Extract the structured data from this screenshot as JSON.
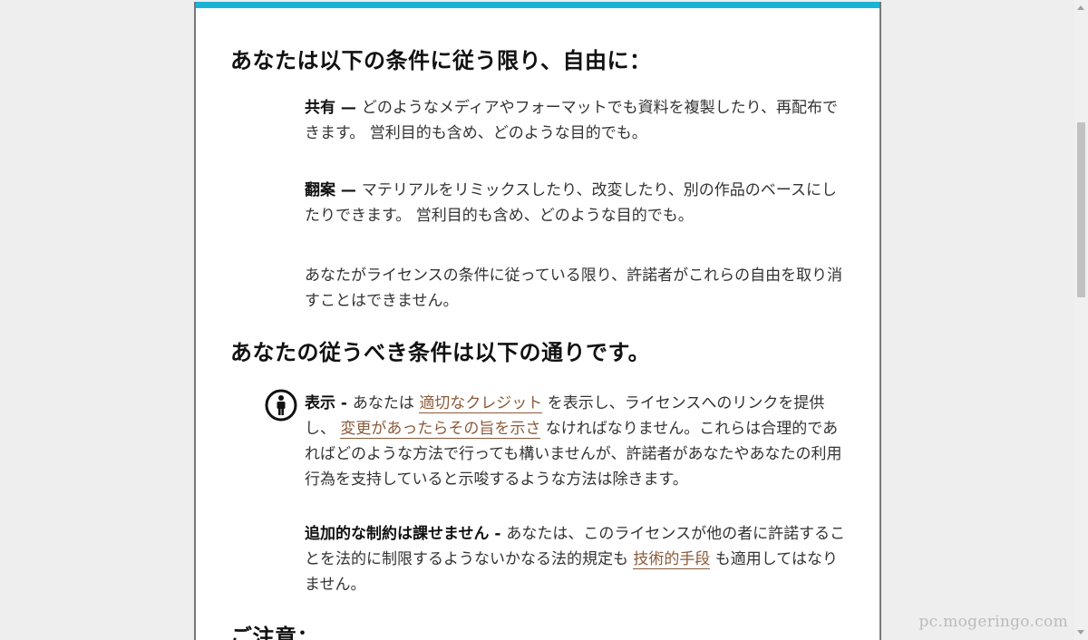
{
  "sections": {
    "freedoms_heading": "あなたは以下の条件に従う限り、自由に：",
    "conditions_heading": "あなたの従うべき条件は以下の通りです。",
    "notice_heading": "ご注意："
  },
  "freedoms": {
    "share": {
      "term": "共有",
      "sep": " — ",
      "text": "どのようなメディアやフォーマットでも資料を複製したり、再配布できます。 営利目的も含め、どのような目的でも。"
    },
    "adapt": {
      "term": "翻案",
      "sep": " — ",
      "text": "マテリアルをリミックスしたり、改変したり、別の作品のベースにしたりできます。 営利目的も含め、どのような目的でも。"
    },
    "revoke_text": "あなたがライセンスの条件に従っている限り、許諾者がこれらの自由を取り消すことはできません。"
  },
  "conditions": {
    "attribution": {
      "term": "表示",
      "sep": " - ",
      "text1": "あなたは ",
      "link1": "適切なクレジット",
      "text2": " を表示し、ライセンスへのリンクを提供し、 ",
      "link2": "変更があったらその旨を示さ",
      "text3": " なければなりません。これらは合理的であればどのような方法で行っても構いませんが、許諾者があなたやあなたの利用行為を支持していると示唆するような方法は除きます。"
    },
    "no_restrictions": {
      "term": "追加的な制約は課せません",
      "sep": " - ",
      "text1": "あなたは、このライセンスが他の者に許諾することを法的に制限するようないかなる法的規定も ",
      "link1": "技術的手段",
      "text2": " も適用してはなりません。"
    }
  },
  "watermark": "pc.mogeringo.com",
  "colors": {
    "accent_bar": "#1bb3d4",
    "link": "#8a5a3a"
  },
  "icons": {
    "attribution": "attribution-person-icon"
  }
}
